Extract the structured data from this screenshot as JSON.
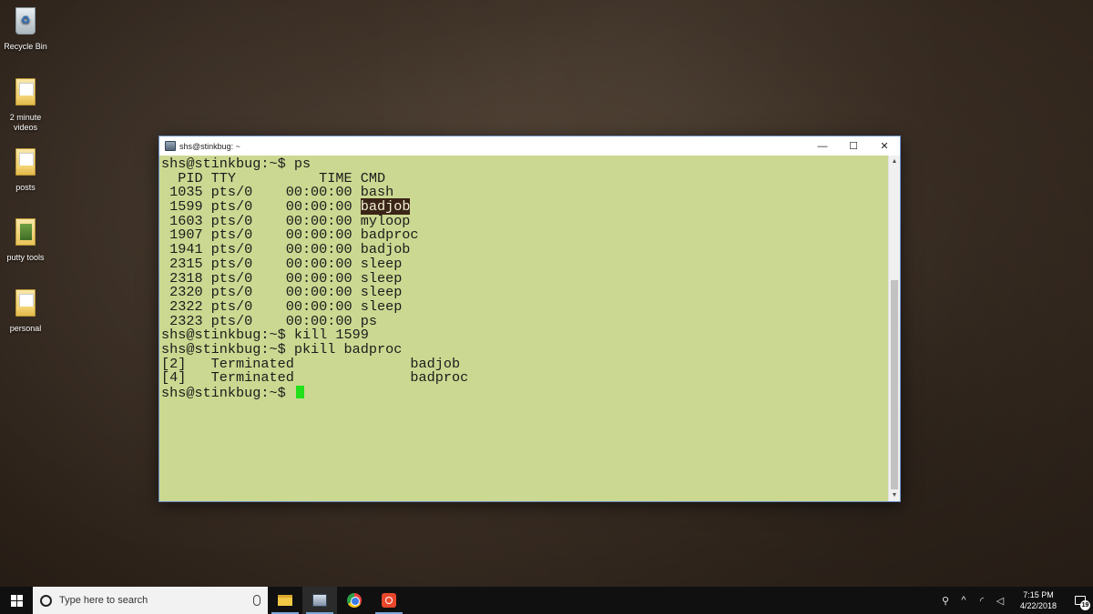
{
  "desktop": {
    "icons": [
      {
        "label": "Recycle Bin"
      },
      {
        "label": "2 minute videos"
      },
      {
        "label": "posts"
      },
      {
        "label": "putty tools"
      },
      {
        "label": "personal"
      }
    ]
  },
  "window": {
    "title": "shs@stinkbug: ~",
    "minimize": "—",
    "maximize": "☐",
    "close": "✕"
  },
  "terminal": {
    "lines": [
      "shs@stinkbug:~$ ps",
      "  PID TTY          TIME CMD",
      " 1035 pts/0    00:00:00 bash",
      " 1599 pts/0    00:00:00 ",
      " 1603 pts/0    00:00:00 myloop",
      " 1907 pts/0    00:00:00 badproc",
      " 1941 pts/0    00:00:00 badjob",
      " 2315 pts/0    00:00:00 sleep",
      " 2318 pts/0    00:00:00 sleep",
      " 2320 pts/0    00:00:00 sleep",
      " 2322 pts/0    00:00:00 sleep",
      " 2323 pts/0    00:00:00 ps",
      "shs@stinkbug:~$ kill 1599",
      "shs@stinkbug:~$ pkill badproc",
      "[2]   Terminated              badjob",
      "[4]   Terminated              badproc",
      "shs@stinkbug:~$ "
    ],
    "highlighted_cmd": "badjob",
    "highlight_line_index": 3,
    "colors": {
      "background": "#cbd891",
      "foreground": "#1b1b1b",
      "cursor": "#22e01a",
      "highlight_bg": "#3a2518"
    }
  },
  "taskbar": {
    "search_placeholder": "Type here to search",
    "apps": [
      "file-explorer",
      "putty",
      "chrome",
      "camera-app"
    ],
    "time": "7:15 PM",
    "date": "4/22/2018",
    "notification_count": "19"
  }
}
